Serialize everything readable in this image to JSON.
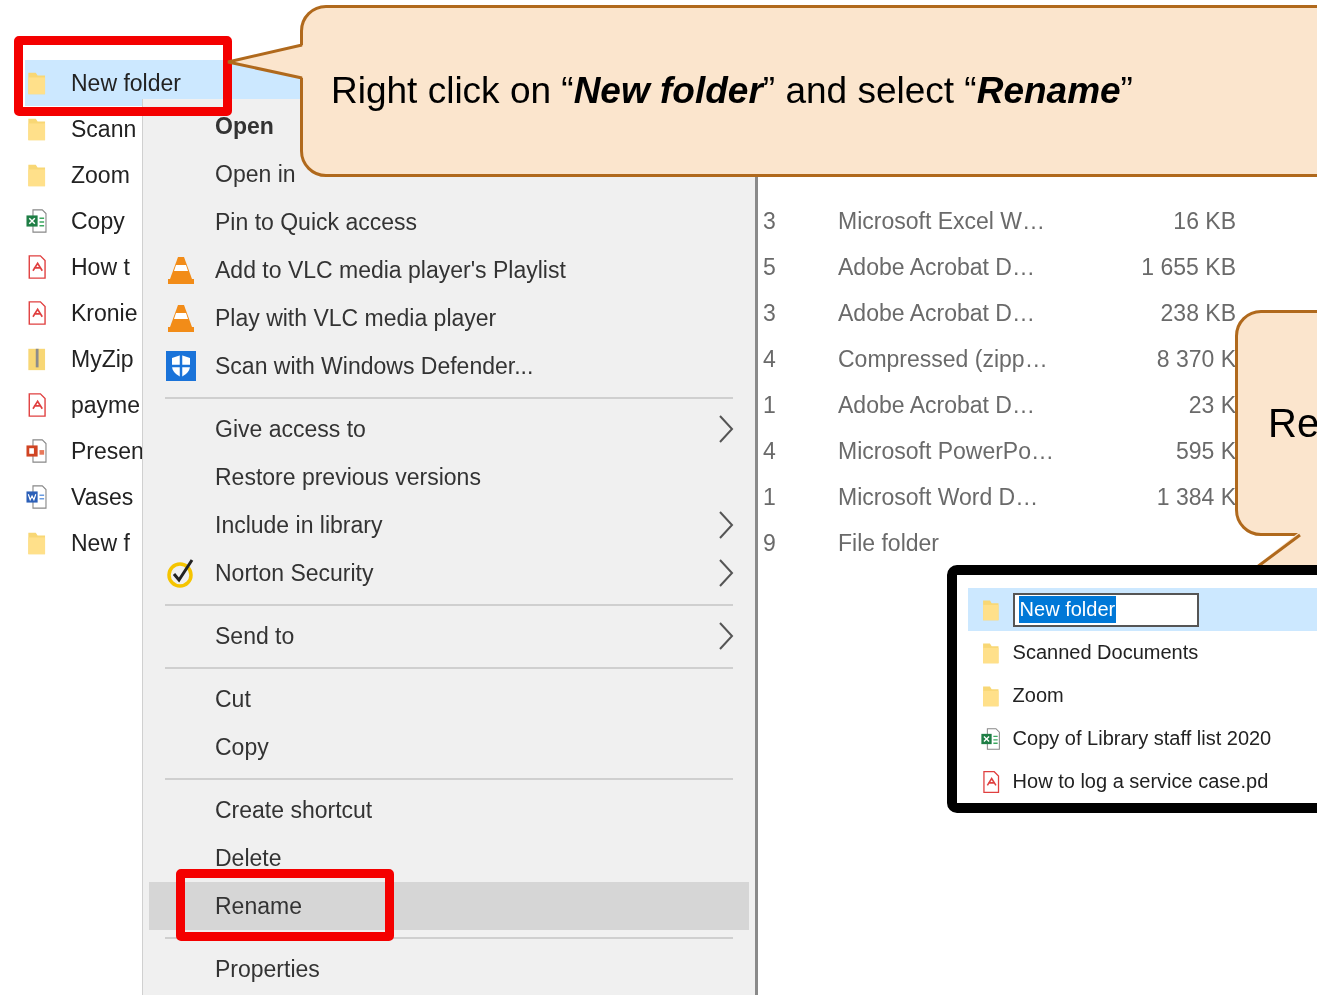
{
  "file_list": {
    "rows": [
      {
        "kind": "folder",
        "name": "New folder",
        "selected": true
      },
      {
        "kind": "folder",
        "name": "Scann",
        "selected": false
      },
      {
        "kind": "folder",
        "name": "Zoom",
        "selected": false
      },
      {
        "kind": "excel",
        "name": "Copy",
        "date": "3",
        "type": "Microsoft Excel W…",
        "size": "16 KB",
        "selected": false
      },
      {
        "kind": "pdf",
        "name": "How t",
        "date": "5",
        "type": "Adobe Acrobat D…",
        "size": "1 655 KB",
        "selected": false
      },
      {
        "kind": "pdf",
        "name": "Kronie",
        "date": "3",
        "type": "Adobe Acrobat D…",
        "size": "238 KB",
        "selected": false
      },
      {
        "kind": "zip",
        "name": "MyZip",
        "date": "4",
        "type": "Compressed (zipp…",
        "size": "8 370 K",
        "selected": false
      },
      {
        "kind": "pdf",
        "name": "payme",
        "date": "1",
        "type": "Adobe Acrobat D…",
        "size": "23 K",
        "selected": false
      },
      {
        "kind": "ppt",
        "name": "Presen",
        "date": "4",
        "type": "Microsoft PowerPo…",
        "size": "595 K",
        "selected": false
      },
      {
        "kind": "word",
        "name": "Vases",
        "date": "1",
        "type": "Microsoft Word D…",
        "size": "1 384 K",
        "selected": false
      },
      {
        "kind": "folder",
        "name": "New f",
        "date": "9",
        "type": "File folder",
        "selected": false
      }
    ]
  },
  "context_menu": {
    "items": [
      {
        "kind": "plain",
        "label": "Open",
        "default": true,
        "submenu": false,
        "selected": false
      },
      {
        "kind": "plain",
        "label": "Open in",
        "default": false,
        "submenu": false,
        "selected": false
      },
      {
        "kind": "plain",
        "label": "Pin to Quick access",
        "default": false,
        "submenu": false,
        "selected": false
      },
      {
        "kind": "cone",
        "label": "Add to VLC media player's Playlist",
        "default": false,
        "submenu": false,
        "selected": false
      },
      {
        "kind": "cone",
        "label": "Play with VLC media player",
        "default": false,
        "submenu": false,
        "selected": false
      },
      {
        "kind": "shield",
        "label": "Scan with Windows Defender...",
        "default": false,
        "submenu": false,
        "selected": false
      },
      {
        "kind": "separator"
      },
      {
        "kind": "plain",
        "label": "Give access to",
        "default": false,
        "submenu": true,
        "selected": false
      },
      {
        "kind": "plain",
        "label": "Restore previous versions",
        "default": false,
        "submenu": false,
        "selected": false
      },
      {
        "kind": "plain",
        "label": "Include in library",
        "default": false,
        "submenu": true,
        "selected": false
      },
      {
        "kind": "check",
        "label": "Norton Security",
        "default": false,
        "submenu": true,
        "selected": false
      },
      {
        "kind": "separator"
      },
      {
        "kind": "plain",
        "label": "Send to",
        "default": false,
        "submenu": true,
        "selected": false
      },
      {
        "kind": "separator"
      },
      {
        "kind": "plain",
        "label": "Cut",
        "default": false,
        "submenu": false,
        "selected": false
      },
      {
        "kind": "plain",
        "label": "Copy",
        "default": false,
        "submenu": false,
        "selected": false
      },
      {
        "kind": "separator"
      },
      {
        "kind": "plain",
        "label": "Create shortcut",
        "default": false,
        "submenu": false,
        "selected": false
      },
      {
        "kind": "plain",
        "label": "Delete",
        "default": false,
        "submenu": false,
        "selected": false
      },
      {
        "kind": "plain",
        "label": "Rename",
        "default": false,
        "submenu": false,
        "selected": true
      },
      {
        "kind": "separator"
      },
      {
        "kind": "plain",
        "label": "Properties",
        "default": false,
        "submenu": false,
        "selected": false
      }
    ]
  },
  "callouts": [
    {
      "text": "Right click on “**New folder**” and select “**Rename**”"
    },
    {
      "text": "Re"
    }
  ],
  "inset": {
    "rows": [
      {
        "kind": "folder",
        "name": "New folder",
        "selected": true
      },
      {
        "kind": "folder",
        "name": "Scanned Documents",
        "selected": false
      },
      {
        "kind": "folder",
        "name": "Zoom",
        "selected": false
      },
      {
        "kind": "excel",
        "name": "Copy of Library staff list 2020",
        "selected": false
      },
      {
        "kind": "pdf",
        "name": "How to log a service case.pd",
        "selected": false
      }
    ]
  }
}
